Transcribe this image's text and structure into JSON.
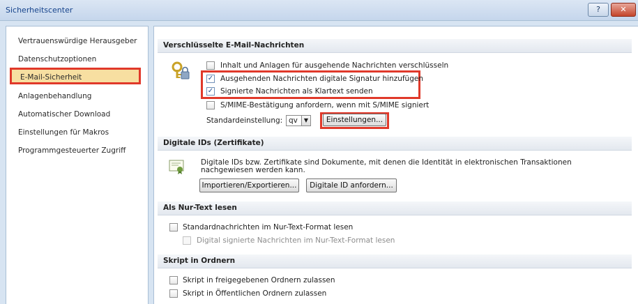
{
  "window": {
    "title": "Sicherheitscenter",
    "help_btn": "?",
    "close_btn": "✕"
  },
  "sidebar": {
    "items": [
      {
        "label": "Vertrauenswürdige Herausgeber"
      },
      {
        "label": "Datenschutzoptionen"
      },
      {
        "label": "E-Mail-Sicherheit",
        "selected": true
      },
      {
        "label": "Anlagenbehandlung"
      },
      {
        "label": "Automatischer Download"
      },
      {
        "label": "Einstellungen für Makros"
      },
      {
        "label": "Programmgesteuerter Zugriff"
      }
    ]
  },
  "encrypted": {
    "header": "Verschlüsselte E-Mail-Nachrichten",
    "options": [
      {
        "label": "Inhalt und Anlagen für ausgehende Nachrichten verschlüsseln",
        "checked": false
      },
      {
        "label": "Ausgehenden Nachrichten digitale Signatur hinzufügen",
        "checked": true
      },
      {
        "label": "Signierte Nachrichten als Klartext senden",
        "checked": true
      },
      {
        "label": "S/MIME-Bestätigung anfordern, wenn mit S/MIME signiert",
        "checked": false
      }
    ],
    "default_label": "Standardeinstellung:",
    "default_value": "qv",
    "settings_button": "Einstellungen..."
  },
  "digital_ids": {
    "header": "Digitale IDs (Zertifikate)",
    "description": "Digitale IDs bzw. Zertifikate sind Dokumente, mit denen die Identität in elektronischen Transaktionen nachgewiesen werden kann.",
    "import_button": "Importieren/Exportieren...",
    "request_button": "Digitale ID anfordern..."
  },
  "plain_text": {
    "header": "Als Nur-Text lesen",
    "options": [
      {
        "label": "Standardnachrichten im Nur-Text-Format lesen",
        "checked": false
      },
      {
        "label": "Digital signierte Nachrichten im Nur-Text-Format lesen",
        "checked": false,
        "disabled": true
      }
    ]
  },
  "folder_script": {
    "header": "Skript in Ordnern",
    "options": [
      {
        "label": "Skript in freigegebenen Ordnern zulassen",
        "checked": false
      },
      {
        "label": "Skript in Öffentlichen Ordnern zulassen",
        "checked": false
      }
    ]
  },
  "check_mark": "✓",
  "colors": {
    "highlight": "#e0392a",
    "selected_bg": "#f7dfa1",
    "title_text": "#15428b"
  }
}
